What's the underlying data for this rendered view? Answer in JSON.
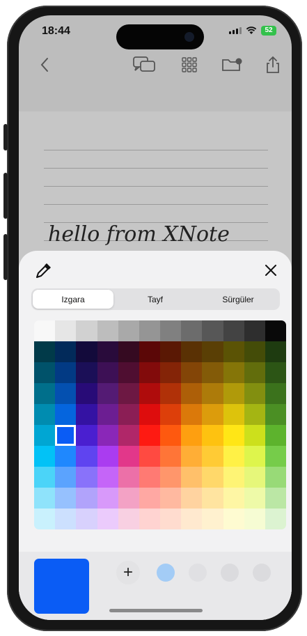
{
  "status_bar": {
    "time": "18:44",
    "battery": "52"
  },
  "toolbar": {
    "back_icon": "chevron-left-icon",
    "chat_icon": "chat-bubbles-icon",
    "grid_icon": "grid-icon",
    "folder_icon": "folder-settings-icon",
    "share_icon": "share-icon"
  },
  "note": {
    "handwriting_text": "hello from XNote"
  },
  "color_picker": {
    "tabs": [
      {
        "label": "Izgara",
        "active": true
      },
      {
        "label": "Tayf",
        "active": false
      },
      {
        "label": "Sürgüler",
        "active": false
      }
    ],
    "selected_color": "#0a5cf5",
    "selected_cell": {
      "row": 5,
      "col": 1
    },
    "grid_rows": [
      [
        "#f8f8f8",
        "#e6e6e6",
        "#d1d1d1",
        "#bdbdbd",
        "#a9a9a9",
        "#959595",
        "#808080",
        "#6c6c6c",
        "#575757",
        "#434343",
        "#2e2e2e",
        "#090909"
      ],
      [
        "#013a49",
        "#022a5a",
        "#130a3b",
        "#290b3b",
        "#350a21",
        "#5b0707",
        "#5a1804",
        "#5a3104",
        "#5a3f05",
        "#5b5305",
        "#444c08",
        "#1e3b10"
      ],
      [
        "#00526a",
        "#023a84",
        "#1b0f57",
        "#3d1055",
        "#4f0e31",
        "#820b0b",
        "#842407",
        "#834507",
        "#835b08",
        "#857508",
        "#626d0c",
        "#2c5515"
      ],
      [
        "#006f8b",
        "#0450b0",
        "#280b77",
        "#541b74",
        "#6d1843",
        "#af0c0c",
        "#b03108",
        "#ad5f08",
        "#ad7b0a",
        "#b09a0a",
        "#828f10",
        "#3b721c"
      ],
      [
        "#008cb0",
        "#0565de",
        "#3412a3",
        "#6c1e92",
        "#8b1e55",
        "#de0d0d",
        "#dd3f0a",
        "#db790a",
        "#dc9c0c",
        "#ddc30c",
        "#a4b513",
        "#4b8f24"
      ],
      [
        "#00a6d3",
        "#0a5cf5",
        "#4a1fd0",
        "#8a27b8",
        "#b02769",
        "#fe1a12",
        "#fe590f",
        "#fe9f10",
        "#fec210",
        "#ffe616",
        "#cce01c",
        "#5db32d"
      ],
      [
        "#02c2f6",
        "#1f88fe",
        "#5f44f0",
        "#aa3cf0",
        "#e2378a",
        "#ff4a41",
        "#ff7537",
        "#ffae36",
        "#ffcb35",
        "#fff146",
        "#def54c",
        "#76cc4a"
      ],
      [
        "#4bd4f8",
        "#5ba3fe",
        "#8972fa",
        "#c565f8",
        "#ec70a8",
        "#ff7a73",
        "#ff966b",
        "#ffc06a",
        "#ffd86a",
        "#fef475",
        "#e6f77a",
        "#98da77"
      ],
      [
        "#8fe3fb",
        "#96c1fe",
        "#b1a3fb",
        "#d899fa",
        "#f3a2c5",
        "#ffa8a3",
        "#ffb9a0",
        "#ffd3a0",
        "#ffe4a0",
        "#fef6a4",
        "#eefaa8",
        "#bbe7a5"
      ],
      [
        "#c9f1fd",
        "#cce0fe",
        "#d8d1fd",
        "#ebcbfc",
        "#f8d0e2",
        "#ffd3d1",
        "#ffdccf",
        "#ffe9cf",
        "#fff1cf",
        "#fefbd1",
        "#f6fcd3",
        "#dcf3d1"
      ]
    ],
    "favorites": [
      "#6ab5ff",
      "#d8d8dc",
      "#cfcfd3",
      "#cfcfd3"
    ]
  }
}
